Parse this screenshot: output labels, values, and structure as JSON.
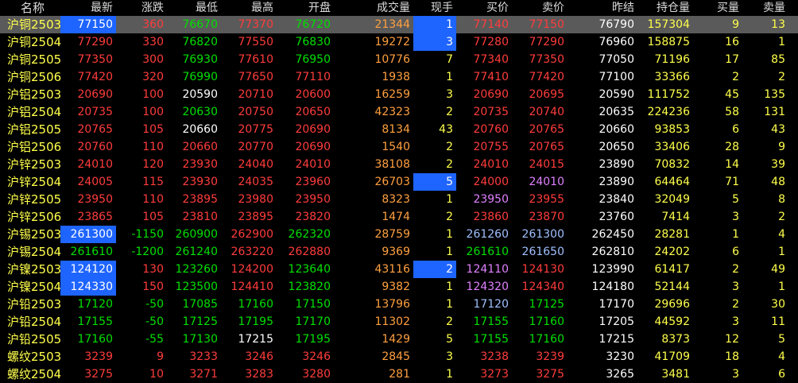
{
  "colors": {
    "up": "#ff3c3c",
    "down": "#00e000",
    "flat": "#ffffff",
    "name": "#ffff4c",
    "volume": "#ffa040",
    "position": "#ffff4c",
    "lots": "#ffff4c",
    "label": "#dcdcdc",
    "highlight": "#1e64ff"
  },
  "headers": [
    "名称",
    "最新",
    "涨跌",
    "最低",
    "最高",
    "开盘",
    "成交量",
    "现手",
    "买价",
    "卖价",
    "昨结",
    "持仓量",
    "买量",
    "卖量"
  ],
  "rows": [
    {
      "name": "沪铜2503",
      "last": "77150",
      "change": "360",
      "low": "76670",
      "high": "77370",
      "open": "76720",
      "volume": "21344",
      "cur": "1",
      "bid": "77140",
      "ask": "77150",
      "prev": "76790",
      "oi": "157304",
      "bidv": "9",
      "askv": "13",
      "lastHl": true,
      "curHl": true,
      "selected": true,
      "lastC": "up",
      "chgC": "up",
      "lowC": "down",
      "highC": "up",
      "openC": "down",
      "bidC": "up",
      "askC": "up"
    },
    {
      "name": "沪铜2504",
      "last": "77290",
      "change": "330",
      "low": "76820",
      "high": "77550",
      "open": "76830",
      "volume": "19272",
      "cur": "3",
      "bid": "77280",
      "ask": "77290",
      "prev": "76960",
      "oi": "158875",
      "bidv": "16",
      "askv": "1",
      "curHl": true,
      "lastC": "up",
      "chgC": "up",
      "lowC": "down",
      "highC": "up",
      "openC": "down",
      "bidC": "up",
      "askC": "up"
    },
    {
      "name": "沪铜2505",
      "last": "77350",
      "change": "300",
      "low": "76930",
      "high": "77610",
      "open": "76950",
      "volume": "10776",
      "cur": "7",
      "bid": "77340",
      "ask": "77350",
      "prev": "77050",
      "oi": "71196",
      "bidv": "17",
      "askv": "85",
      "lastC": "up",
      "chgC": "up",
      "lowC": "down",
      "highC": "up",
      "openC": "down",
      "bidC": "up",
      "askC": "up"
    },
    {
      "name": "沪铜2506",
      "last": "77420",
      "change": "320",
      "low": "76990",
      "high": "77650",
      "open": "77110",
      "volume": "1938",
      "cur": "1",
      "bid": "77410",
      "ask": "77420",
      "prev": "77100",
      "oi": "33366",
      "bidv": "2",
      "askv": "2",
      "lastC": "up",
      "chgC": "up",
      "lowC": "down",
      "highC": "up",
      "openC": "up",
      "bidC": "up",
      "askC": "up"
    },
    {
      "name": "沪铝2503",
      "last": "20690",
      "change": "100",
      "low": "20590",
      "high": "20710",
      "open": "20600",
      "volume": "16259",
      "cur": "3",
      "bid": "20690",
      "ask": "20695",
      "prev": "20590",
      "oi": "111752",
      "bidv": "45",
      "askv": "135",
      "lastC": "up",
      "chgC": "up",
      "lowC": "flat",
      "highC": "up",
      "openC": "up",
      "bidC": "up",
      "askC": "up"
    },
    {
      "name": "沪铝2504",
      "last": "20735",
      "change": "100",
      "low": "20630",
      "high": "20750",
      "open": "20650",
      "volume": "42323",
      "cur": "2",
      "bid": "20735",
      "ask": "20740",
      "prev": "20635",
      "oi": "224236",
      "bidv": "58",
      "askv": "131",
      "lastC": "up",
      "chgC": "up",
      "lowC": "down",
      "highC": "up",
      "openC": "up",
      "bidC": "up",
      "askC": "up"
    },
    {
      "name": "沪铝2505",
      "last": "20765",
      "change": "105",
      "low": "20660",
      "high": "20775",
      "open": "20690",
      "volume": "8134",
      "cur": "43",
      "bid": "20760",
      "ask": "20765",
      "prev": "20660",
      "oi": "93853",
      "bidv": "6",
      "askv": "43",
      "lastC": "up",
      "chgC": "up",
      "lowC": "flat",
      "highC": "up",
      "openC": "up",
      "bidC": "up",
      "askC": "up"
    },
    {
      "name": "沪铝2506",
      "last": "20760",
      "change": "110",
      "low": "20660",
      "high": "20770",
      "open": "20690",
      "volume": "1540",
      "cur": "2",
      "bid": "20755",
      "ask": "20765",
      "prev": "20650",
      "oi": "33406",
      "bidv": "28",
      "askv": "9",
      "lastC": "up",
      "chgC": "up",
      "lowC": "up",
      "highC": "up",
      "openC": "up",
      "bidC": "up",
      "askC": "up"
    },
    {
      "name": "沪锌2503",
      "last": "24010",
      "change": "120",
      "low": "23930",
      "high": "24040",
      "open": "24010",
      "volume": "38108",
      "cur": "2",
      "bid": "24010",
      "ask": "24015",
      "prev": "23890",
      "oi": "70832",
      "bidv": "14",
      "askv": "39",
      "lastC": "up",
      "chgC": "up",
      "lowC": "up",
      "highC": "up",
      "openC": "up",
      "bidC": "up",
      "askC": "up"
    },
    {
      "name": "沪锌2504",
      "last": "24005",
      "change": "115",
      "low": "23930",
      "high": "24035",
      "open": "23960",
      "volume": "26703",
      "cur": "5",
      "bid": "24000",
      "ask": "24010",
      "prev": "23890",
      "oi": "64464",
      "bidv": "71",
      "askv": "48",
      "curHl": true,
      "lastC": "up",
      "chgC": "up",
      "lowC": "up",
      "highC": "up",
      "openC": "up",
      "bidC": "up",
      "askC": "up"
    },
    {
      "name": "沪锌2505",
      "last": "23950",
      "change": "110",
      "low": "23895",
      "high": "23980",
      "open": "23950",
      "volume": "8323",
      "cur": "1",
      "bid": "23950",
      "ask": "23955",
      "prev": "23840",
      "oi": "32049",
      "bidv": "5",
      "askv": "8",
      "lastC": "up",
      "chgC": "up",
      "lowC": "up",
      "highC": "up",
      "openC": "up",
      "bidC": "up",
      "askC": "up"
    },
    {
      "name": "沪锌2506",
      "last": "23865",
      "change": "105",
      "low": "23810",
      "high": "23895",
      "open": "23820",
      "volume": "1474",
      "cur": "2",
      "bid": "23860",
      "ask": "23870",
      "prev": "23760",
      "oi": "7414",
      "bidv": "3",
      "askv": "2",
      "lastC": "up",
      "chgC": "up",
      "lowC": "up",
      "highC": "up",
      "openC": "up",
      "bidC": "up",
      "askC": "up"
    },
    {
      "name": "沪锡2503",
      "last": "261300",
      "change": "-1150",
      "low": "260900",
      "high": "262900",
      "open": "262320",
      "volume": "28759",
      "cur": "1",
      "bid": "261260",
      "ask": "261300",
      "prev": "262450",
      "oi": "28281",
      "bidv": "1",
      "askv": "4",
      "lastHl": true,
      "lastC": "down",
      "chgC": "down",
      "lowC": "down",
      "highC": "up",
      "openC": "down",
      "bidC": "down",
      "askC": "down"
    },
    {
      "name": "沪锡2504",
      "last": "261610",
      "change": "-1200",
      "low": "261240",
      "high": "263220",
      "open": "262880",
      "volume": "9369",
      "cur": "1",
      "bid": "261610",
      "ask": "261650",
      "prev": "262810",
      "oi": "24202",
      "bidv": "6",
      "askv": "1",
      "lastC": "down",
      "chgC": "down",
      "lowC": "down",
      "highC": "up",
      "openC": "up",
      "bidC": "down",
      "askC": "down"
    },
    {
      "name": "沪镍2503",
      "last": "124120",
      "change": "130",
      "low": "123260",
      "high": "124200",
      "open": "123640",
      "volume": "43116",
      "cur": "2",
      "bid": "124110",
      "ask": "124130",
      "prev": "123990",
      "oi": "61417",
      "bidv": "2",
      "askv": "49",
      "lastHl": true,
      "curHl": true,
      "lastC": "up",
      "chgC": "up",
      "lowC": "down",
      "highC": "up",
      "openC": "down",
      "bidC": "up",
      "askC": "up"
    },
    {
      "name": "沪镍2504",
      "last": "124330",
      "change": "150",
      "low": "123500",
      "high": "124410",
      "open": "123820",
      "volume": "9382",
      "cur": "1",
      "bid": "124320",
      "ask": "124340",
      "prev": "124180",
      "oi": "52144",
      "bidv": "3",
      "askv": "1",
      "lastHl": true,
      "lastC": "up",
      "chgC": "up",
      "lowC": "down",
      "highC": "up",
      "openC": "down",
      "bidC": "up",
      "askC": "up"
    },
    {
      "name": "沪铅2503",
      "last": "17120",
      "change": "-50",
      "low": "17085",
      "high": "17160",
      "open": "17150",
      "volume": "13796",
      "cur": "1",
      "bid": "17120",
      "ask": "17125",
      "prev": "17170",
      "oi": "29696",
      "bidv": "2",
      "askv": "30",
      "lastC": "down",
      "chgC": "down",
      "lowC": "down",
      "highC": "down",
      "openC": "down",
      "bidC": "down",
      "askC": "down"
    },
    {
      "name": "沪铅2504",
      "last": "17155",
      "change": "-50",
      "low": "17125",
      "high": "17195",
      "open": "17170",
      "volume": "11302",
      "cur": "2",
      "bid": "17155",
      "ask": "17160",
      "prev": "17205",
      "oi": "44592",
      "bidv": "3",
      "askv": "11",
      "lastC": "down",
      "chgC": "down",
      "lowC": "down",
      "highC": "down",
      "openC": "down",
      "bidC": "down",
      "askC": "down"
    },
    {
      "name": "沪铅2505",
      "last": "17160",
      "change": "-55",
      "low": "17130",
      "high": "17215",
      "open": "17195",
      "volume": "1429",
      "cur": "5",
      "bid": "17155",
      "ask": "17160",
      "prev": "17215",
      "oi": "8373",
      "bidv": "12",
      "askv": "5",
      "lastC": "down",
      "chgC": "down",
      "lowC": "down",
      "highC": "flat",
      "openC": "down",
      "bidC": "down",
      "askC": "down"
    },
    {
      "name": "螺纹2503",
      "last": "3239",
      "change": "9",
      "low": "3233",
      "high": "3246",
      "open": "3246",
      "volume": "2845",
      "cur": "3",
      "bid": "3238",
      "ask": "3239",
      "prev": "3230",
      "oi": "41709",
      "bidv": "18",
      "askv": "4",
      "lastC": "up",
      "chgC": "up",
      "lowC": "up",
      "highC": "up",
      "openC": "up",
      "bidC": "up",
      "askC": "up"
    },
    {
      "name": "螺纹2504",
      "last": "3275",
      "change": "10",
      "low": "3271",
      "high": "3283",
      "open": "3280",
      "volume": "281",
      "cur": "1",
      "bid": "3273",
      "ask": "3275",
      "prev": "3265",
      "oi": "3481",
      "bidv": "3",
      "askv": "6",
      "lastC": "up",
      "chgC": "up",
      "lowC": "up",
      "highC": "up",
      "openC": "up",
      "bidC": "up",
      "askC": "up"
    }
  ]
}
